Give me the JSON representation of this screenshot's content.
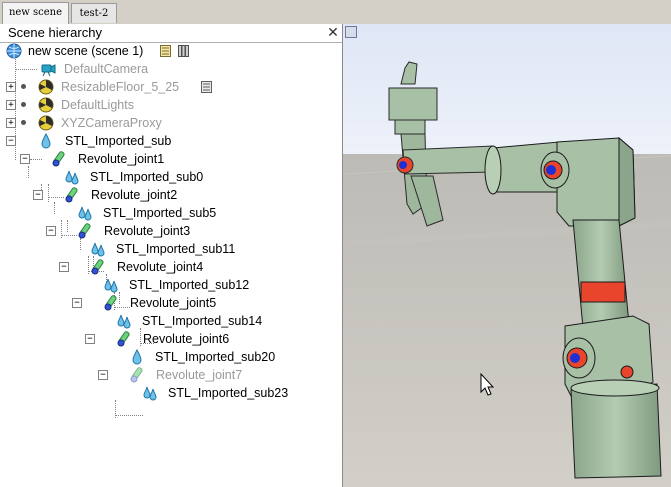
{
  "tabs": [
    {
      "label": "new scene",
      "active": true
    },
    {
      "label": "test-2",
      "active": false
    }
  ],
  "panel": {
    "title": "Scene hierarchy",
    "close_glyph": "✕"
  },
  "tree": {
    "root": "new scene (scene 1)",
    "items": [
      {
        "label": "DefaultCamera",
        "icon": "camera-icon",
        "gray": true
      },
      {
        "label": "ResizableFloor_5_25",
        "icon": "floor-icon",
        "gray": true
      },
      {
        "label": "DefaultLights",
        "icon": "lights-icon",
        "gray": true
      },
      {
        "label": "XYZCameraProxy",
        "icon": "proxy-icon",
        "gray": true
      },
      {
        "label": "STL_Imported_sub",
        "icon": "shape-icon",
        "gray": false
      },
      {
        "label": "Revolute_joint1",
        "icon": "joint-icon",
        "gray": false
      },
      {
        "label": "STL_Imported_sub0",
        "icon": "shape-icon",
        "gray": false
      },
      {
        "label": "Revolute_joint2",
        "icon": "joint-icon",
        "gray": false
      },
      {
        "label": "STL_Imported_sub5",
        "icon": "shape-icon",
        "gray": false
      },
      {
        "label": "Revolute_joint3",
        "icon": "joint-icon",
        "gray": false
      },
      {
        "label": "STL_Imported_sub11",
        "icon": "shape-icon",
        "gray": false
      },
      {
        "label": "Revolute_joint4",
        "icon": "joint-icon",
        "gray": false
      },
      {
        "label": "STL_Imported_sub12",
        "icon": "shape-icon",
        "gray": false
      },
      {
        "label": "Revolute_joint5",
        "icon": "joint-icon",
        "gray": false
      },
      {
        "label": "STL_Imported_sub14",
        "icon": "shape-icon",
        "gray": false
      },
      {
        "label": "Revolute_joint6",
        "icon": "joint-icon",
        "gray": false
      },
      {
        "label": "STL_Imported_sub20",
        "icon": "shape-icon",
        "gray": false
      },
      {
        "label": "Revolute_joint7",
        "icon": "joint-icon",
        "gray": true
      },
      {
        "label": "STL_Imported_sub23",
        "icon": "shape-icon",
        "gray": false
      }
    ]
  },
  "colors": {
    "robot_body": "#a7c0a6",
    "robot_dark": "#7f9a80",
    "joint_red": "#e8452c",
    "joint_blue": "#1f2fd6",
    "floor": "#c9c7c2",
    "sky": "#e4eaf6"
  }
}
